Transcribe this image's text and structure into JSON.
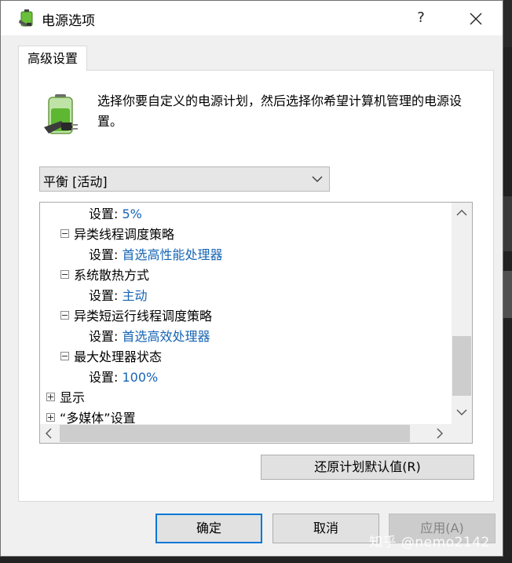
{
  "window": {
    "title": "电源选项",
    "help_glyph": "?",
    "close_icon": "close-icon"
  },
  "tab": {
    "label": "高级设置"
  },
  "description": "选择你要自定义的电源计划，然后选择你希望计算机管理的电源设置。",
  "plan_select": {
    "value": "平衡 [活动]"
  },
  "tree": {
    "rows": [
      {
        "label": "设置: ",
        "value": "5%"
      },
      {
        "label": "异类线程调度策略",
        "expander": "minus"
      },
      {
        "label": "设置: ",
        "value": "首选高性能处理器"
      },
      {
        "label": "系统散热方式",
        "expander": "minus"
      },
      {
        "label": "设置: ",
        "value": "主动"
      },
      {
        "label": "异类短运行线程调度策略",
        "expander": "minus"
      },
      {
        "label": "设置: ",
        "value": "首选高效处理器"
      },
      {
        "label": "最大处理器状态",
        "expander": "minus"
      },
      {
        "label": "设置: ",
        "value": "100%"
      },
      {
        "label": "显示",
        "expander": "plus"
      },
      {
        "label": "“多媒体”设置",
        "expander": "plus"
      }
    ]
  },
  "buttons": {
    "restore": "还原计划默认值(R)",
    "ok": "确定",
    "cancel": "取消",
    "apply": "应用(A)"
  },
  "watermark": "知乎 @nemo2142",
  "colors": {
    "link": "#1664b4",
    "focus_border": "#0078d7"
  }
}
